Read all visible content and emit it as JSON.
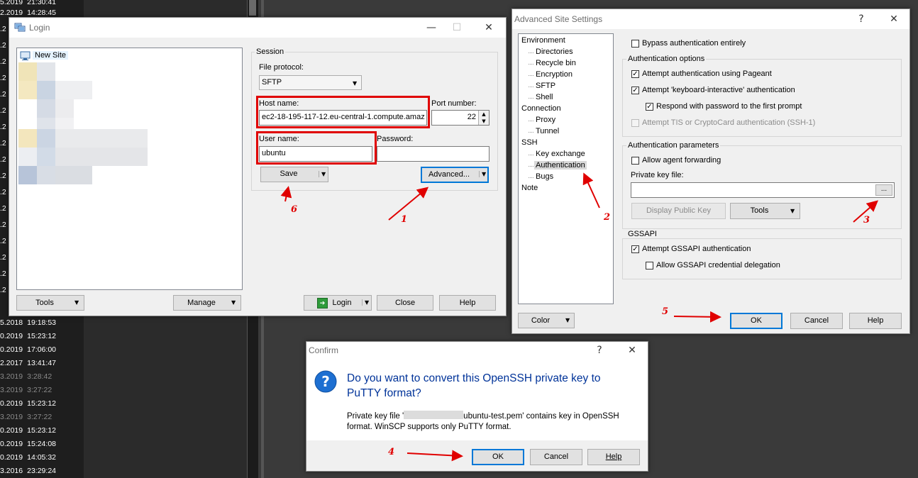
{
  "background": {
    "timestamps": [
      {
        "date": "5.2019",
        "time": "21:30:41",
        "dim": false
      },
      {
        "date": "2.2019",
        "time": "14:28:45",
        "dim": false
      },
      {
        "date": "5.2018",
        "time": "19:18:53",
        "dim": false
      },
      {
        "date": "0.2019",
        "time": "15:23:12",
        "dim": false
      },
      {
        "date": "0.2019",
        "time": "17:06:00",
        "dim": false
      },
      {
        "date": "2.2017",
        "time": "13:41:47",
        "dim": false
      },
      {
        "date": "3.2019",
        "time": "3:28:42",
        "dim": true
      },
      {
        "date": "3.2019",
        "time": "3:27:22",
        "dim": true
      },
      {
        "date": "0.2019",
        "time": "15:23:12",
        "dim": false
      },
      {
        "date": "3.2019",
        "time": "3:27:22",
        "dim": true
      },
      {
        "date": "0.2019",
        "time": "15:23:12",
        "dim": false
      },
      {
        "date": "0.2019",
        "time": "15:24:08",
        "dim": false
      },
      {
        "date": "0.2019",
        "time": "14:05:32",
        "dim": false
      },
      {
        "date": "3.2016",
        "time": "23:29:24",
        "dim": false
      }
    ],
    "left_edge": [
      ".2",
      ".2",
      ".2",
      ".2",
      ".2",
      ".2",
      ".2",
      ".2",
      ".2",
      ".2",
      ".2",
      ".2",
      ".2",
      ".2",
      ".2",
      ".2",
      ".2"
    ]
  },
  "login": {
    "title": "Login",
    "tree_item": "New Site",
    "session_label": "Session",
    "file_protocol_label": "File protocol:",
    "file_protocol_value": "SFTP",
    "host_label": "Host name:",
    "host_value": "ec2-18-195-117-12.eu-central-1.compute.amaz",
    "port_label": "Port number:",
    "port_value": "22",
    "user_label": "User name:",
    "user_value": "ubuntu",
    "password_label": "Password:",
    "password_value": "",
    "save_button": "Save",
    "advanced_button": "Advanced...",
    "tools_button": "Tools",
    "manage_button": "Manage",
    "login_button": "Login",
    "close_button": "Close",
    "help_button": "Help"
  },
  "advanced": {
    "title": "Advanced Site Settings",
    "help_glyph": "?",
    "tree": [
      {
        "label": "Environment",
        "level": 0
      },
      {
        "label": "Directories",
        "level": 1
      },
      {
        "label": "Recycle bin",
        "level": 1
      },
      {
        "label": "Encryption",
        "level": 1
      },
      {
        "label": "SFTP",
        "level": 1
      },
      {
        "label": "Shell",
        "level": 1
      },
      {
        "label": "Connection",
        "level": 0
      },
      {
        "label": "Proxy",
        "level": 1
      },
      {
        "label": "Tunnel",
        "level": 1
      },
      {
        "label": "SSH",
        "level": 0
      },
      {
        "label": "Key exchange",
        "level": 1
      },
      {
        "label": "Authentication",
        "level": 1,
        "selected": true
      },
      {
        "label": "Bugs",
        "level": 1
      },
      {
        "label": "Note",
        "level": 0
      }
    ],
    "bypass_label": "Bypass authentication entirely",
    "bypass_checked": false,
    "auth_options_label": "Authentication options",
    "pageant_label": "Attempt authentication using Pageant",
    "pageant_checked": true,
    "kbd_label": "Attempt 'keyboard-interactive' authentication",
    "kbd_checked": true,
    "respond_label": "Respond with password to the first prompt",
    "respond_checked": true,
    "tis_label": "Attempt TIS or CryptoCard authentication (SSH-1)",
    "tis_checked": false,
    "auth_params_label": "Authentication parameters",
    "agent_fwd_label": "Allow agent forwarding",
    "agent_fwd_checked": false,
    "private_key_label": "Private key file:",
    "private_key_value": "",
    "browse_button": "...",
    "display_public_key_button": "Display Public Key",
    "tools_button": "Tools",
    "gssapi_group_label": "GSSAPI",
    "gssapi_label": "Attempt GSSAPI authentication",
    "gssapi_checked": true,
    "gssapi_deleg_label": "Allow GSSAPI credential delegation",
    "gssapi_deleg_checked": false,
    "color_button": "Color",
    "ok_button": "OK",
    "cancel_button": "Cancel",
    "help_button": "Help"
  },
  "confirm": {
    "title": "Confirm",
    "help_glyph": "?",
    "question": "Do you want to convert this OpenSSH private key to PuTTY format?",
    "message_prefix": "Private key file '",
    "message_suffix": "ubuntu-test.pem' contains key in OpenSSH",
    "message_line2": "format. WinSCP supports only PuTTY format.",
    "ok_button": "OK",
    "cancel_button": "Cancel",
    "help_button": "Help"
  },
  "annotations": {
    "step1": "1",
    "step2": "2",
    "step3": "3",
    "step4": "4",
    "step5": "5",
    "step6": "6"
  },
  "colors": {
    "annotation_red": "#e00000",
    "focus_blue": "#0078d7",
    "question_icon_blue": "#1d6fd1",
    "question_text_blue": "#003399"
  }
}
